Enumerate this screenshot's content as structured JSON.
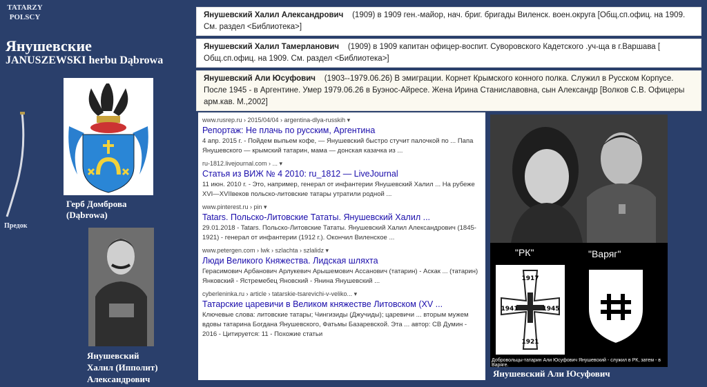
{
  "header": {
    "line1": "TATARZY",
    "line2": "POLSCY"
  },
  "family": {
    "title": "Янушевские",
    "subtitle": "JANUSZEWSKI herbu Dąbrowa"
  },
  "predok": "Предок",
  "coat_caption": {
    "line1": "Герб Домброва",
    "line2": "(Dąbrowa)"
  },
  "portrait_caption": {
    "line1": "Янушевский",
    "line2": "Халил (Ипполит)",
    "line3": "Александрович"
  },
  "notes": [
    {
      "name": "Янушевский Халил Александрович",
      "text": "(1909) в 1909 ген.-майор, нач. бриг. бригады Виленск. воен.округа [Общ.сп.офиц. на 1909. См. раздел <Библиотека>]"
    },
    {
      "name": "Янушевский Халил Тамерланович",
      "text": "(1909) в 1909 капитан офицер-воспит. Суворовского Кадетского .уч-ща в г.Варшава [ Общ.сп.офиц. на 1909. См. раздел <Библиотека>]"
    },
    {
      "name": "Янушевский Али Юсуфович",
      "text": "(1903--1979.06.26) В эмиграции. Корнет Крымского конного полка. Служил в Русском Корпусе. После 1945 - в Аргентине. Умер 1979.06.26 в Буэнос-Айресе. Жена Ирина Станиславовна, сын Александр [Волков С.В. Офицеры арм.кав. М.,2002]"
    }
  ],
  "results": [
    {
      "url": "www.rusrep.ru › 2015/04/04 › argentina-dlya-russkih ▾",
      "title": "Репортаж: Не плачь по русским, Аргентина",
      "snippet": "4 апр. 2015 г. - Пойдем выпьем кофе, — Янушевский быстро стучит палочкой по ... Папа Янушевского — крымский татарин, мама — донская казачка из ..."
    },
    {
      "url": "ru-1812.livejournal.com › ... ▾",
      "title": "Статья из ВИЖ № 4 2010: ru_1812 — LiveJournal",
      "snippet": "11 июн. 2010 г. - Это, например, генерал от инфантерии Янушевский Халил ... На рубеже XVI—XVIIвеков польско-литовские татары утратили родной ..."
    },
    {
      "url": "www.pinterest.ru › pin ▾",
      "title": "Tatars. Польско-Литовские Тататы. Янушевский Халил ...",
      "snippet": "29.01.2018 - Tatars. Польско-Литовские Тататы. Янушевский Халил Александрович (1845-1921) - генерал от инфантерии (1912 г.). Окончил Виленское ..."
    },
    {
      "url": "www.petergen.com › lwk › szlachta › szlalidz ▾",
      "title": "Люди Великого Княжества. Лидская шляхта",
      "snippet": "Герасимович Арбанович Арлукевич Арышемович Ассанович (татарин) - Аскак ... (татарин) Янковский - Ястремебец Яновский - Янина Янушевский ..."
    },
    {
      "url": "cyberleninka.ru › article › tatarskie-tsarevichi-v-veliko... ▾",
      "title": "Татарские царевичи в Великом княжестве Литовском (XV ...",
      "snippet": "Ключевые слова: литовские татары; Чингизиды (Джучиды); царевичи ... вторым мужем вдовы татарина Богдана Янушевского, Фатьмы Базаревской. Эта ... автор: СВ Думин - 2016 - Цитируется: 11 - Похожие статьи"
    }
  ],
  "badges": {
    "left_label": "\"РК\"",
    "right_label": "\"Варяг\"",
    "cross_years": [
      "1917",
      "1941",
      "1945",
      "1921"
    ],
    "caption": "Добровольцы-татарин Али Юсуфович Янушевский - служил в РК, затем - в Варяге."
  },
  "ali_caption": "Янушевский Али Юсуфович",
  "colors": {
    "background": "#2a3f6b",
    "link": "#1a0dab"
  }
}
